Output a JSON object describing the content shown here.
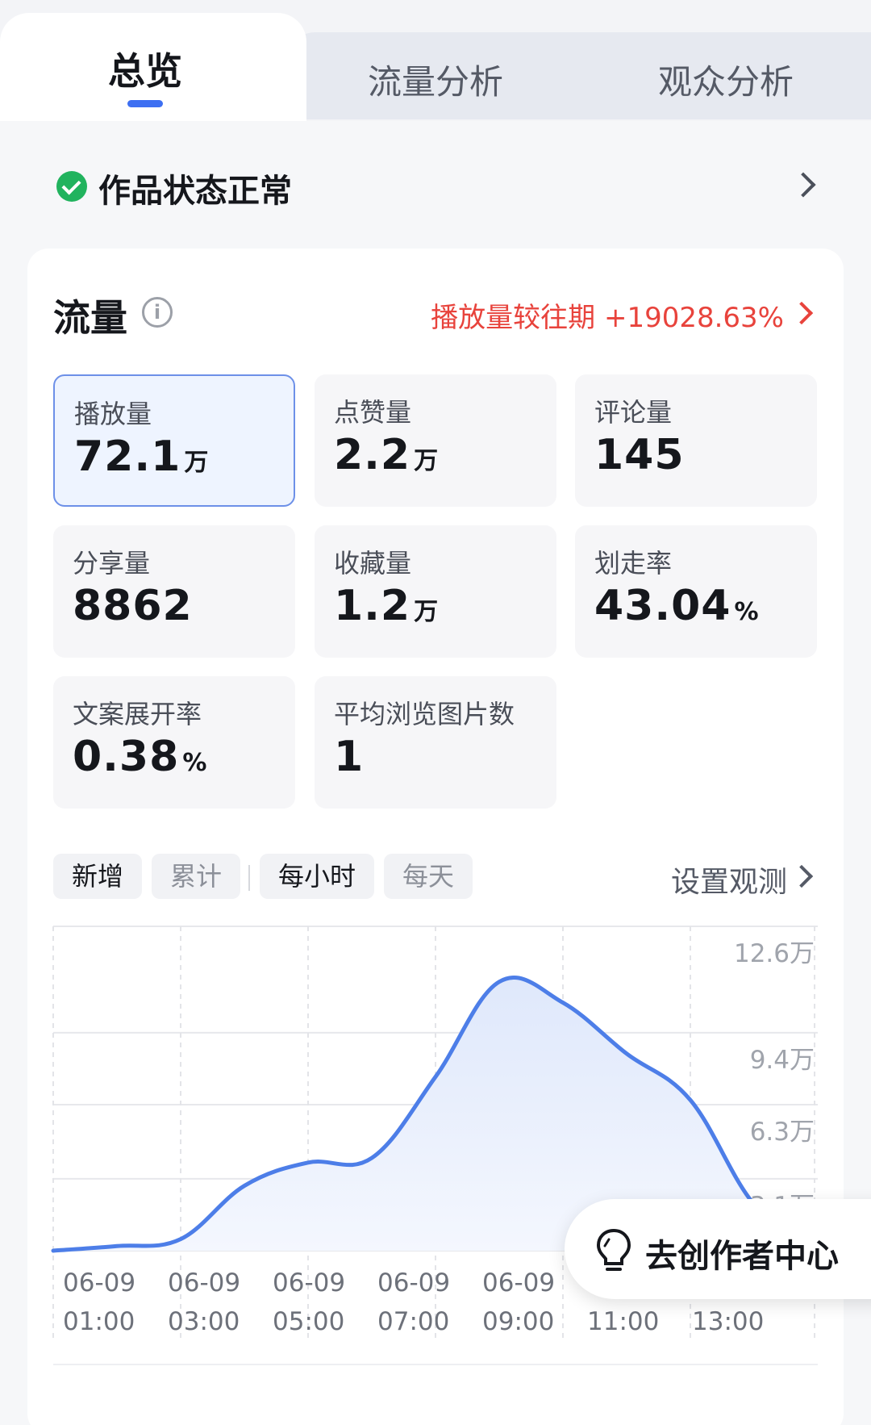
{
  "tabs": [
    {
      "label": "总览",
      "active": true
    },
    {
      "label": "流量分析",
      "active": false
    },
    {
      "label": "观众分析",
      "active": false
    }
  ],
  "status": {
    "icon": "check-circle-icon",
    "text": "作品状态正常"
  },
  "traffic": {
    "title": "流量",
    "compare_text": "播放量较往期 +19028.63%",
    "accent_color": "#e8433c",
    "metrics": [
      {
        "label": "播放量",
        "value": "72.1",
        "unit": "万",
        "selected": true
      },
      {
        "label": "点赞量",
        "value": "2.2",
        "unit": "万",
        "selected": false
      },
      {
        "label": "评论量",
        "value": "145",
        "unit": "",
        "selected": false
      },
      {
        "label": "分享量",
        "value": "8862",
        "unit": "",
        "selected": false
      },
      {
        "label": "收藏量",
        "value": "1.2",
        "unit": "万",
        "selected": false
      },
      {
        "label": "划走率",
        "value": "43.04",
        "unit": "%",
        "selected": false
      },
      {
        "label": "文案展开率",
        "value": "0.38",
        "unit": "%",
        "selected": false
      },
      {
        "label": "平均浏览图片数",
        "value": "1",
        "unit": "",
        "selected": false
      }
    ]
  },
  "filters": {
    "mode": [
      {
        "label": "新增",
        "active": true
      },
      {
        "label": "累计",
        "active": false
      }
    ],
    "granularity": [
      {
        "label": "每小时",
        "active": true
      },
      {
        "label": "每天",
        "active": false
      }
    ],
    "observe_label": "设置观测"
  },
  "chart_data": {
    "type": "area",
    "color": "#4d7ee8",
    "y_tick_labels": [
      "12.6万",
      "9.4万",
      "6.3万",
      "3.1万"
    ],
    "y_tick_values": [
      126000,
      94000,
      63000,
      31000
    ],
    "ylim": [
      0,
      126000
    ],
    "x_tick_labels": [
      [
        "06-09",
        "01:00"
      ],
      [
        "06-09",
        "03:00"
      ],
      [
        "06-09",
        "05:00"
      ],
      [
        "06-09",
        "07:00"
      ],
      [
        "06-09",
        "09:00"
      ],
      [
        "06-09",
        "11:00"
      ],
      [
        "06-09",
        "13:00"
      ]
    ],
    "x_hours": [
      1,
      2,
      3,
      4,
      5,
      6,
      7,
      8,
      9,
      10,
      11,
      12,
      13
    ],
    "values": [
      0,
      2000,
      5000,
      28000,
      38000,
      40000,
      75000,
      116000,
      107000,
      85000,
      65000,
      20000,
      0
    ],
    "grid": true
  },
  "float_button": {
    "label": "去创作者中心",
    "icon": "lightbulb-icon"
  }
}
